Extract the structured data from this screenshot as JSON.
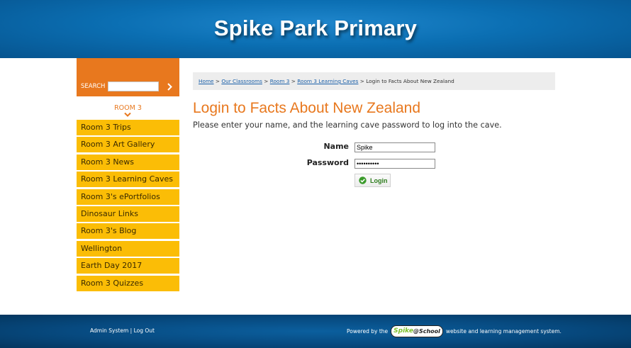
{
  "header": {
    "title": "Spike Park Primary"
  },
  "search": {
    "label": "SEARCH",
    "placeholder": "",
    "value": ""
  },
  "sidebar": {
    "heading": "ROOM 3",
    "items": [
      {
        "label": "Room 3 Trips"
      },
      {
        "label": "Room 3 Art Gallery"
      },
      {
        "label": "Room 3 News"
      },
      {
        "label": "Room 3 Learning Caves"
      },
      {
        "label": "Room 3's ePortfolios"
      },
      {
        "label": "Dinosaur Links"
      },
      {
        "label": "Room 3's Blog"
      },
      {
        "label": "Wellington"
      },
      {
        "label": "Earth Day 2017"
      },
      {
        "label": "Room 3 Quizzes"
      }
    ]
  },
  "breadcrumb": {
    "items": [
      "Home",
      "Our Classrooms",
      "Room 3",
      "Room 3 Learning Caves"
    ],
    "separator": ">",
    "current": "Login to Facts About New Zealand"
  },
  "main": {
    "title": "Login to Facts About New Zealand",
    "intro": "Please enter your name, and the learning cave password to log into the cave."
  },
  "form": {
    "name_label": "Name",
    "name_value": "Spike",
    "password_label": "Password",
    "password_value": "••••••••••",
    "login_label": "Login"
  },
  "footer": {
    "admin_link": "Admin System",
    "divider": "|",
    "logout_link": "Log Out",
    "powered_prefix": "Powered by the",
    "logo_text_1": "Spike",
    "logo_text_2": "@School",
    "powered_suffix": "website and learning management system."
  },
  "colors": {
    "header_blue": "#0b6fb3",
    "accent_orange": "#e8781e",
    "nav_yellow": "#fbbd06",
    "footer_blue": "#074a80",
    "login_green": "#2e7d1e"
  },
  "icons": {
    "search_go": "chevron-right-icon",
    "room_chevron": "chevron-down-icon",
    "login": "check-circle-icon"
  }
}
